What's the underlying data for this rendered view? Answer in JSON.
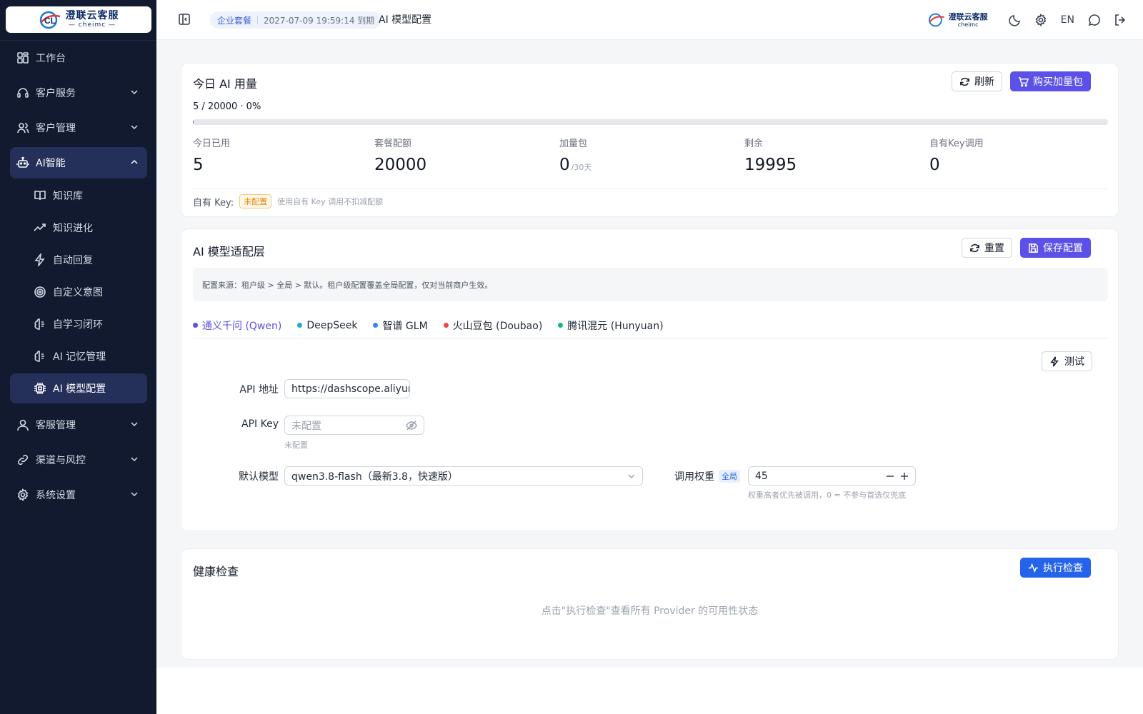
{
  "app": {
    "logo_title": "澄联云客服",
    "logo_sub": "cheimc"
  },
  "topbar": {
    "plan_name": "企业套餐",
    "plan_expiry": "2027-07-09 19:59:14 到期",
    "page_title": "AI 模型配置",
    "lang": "EN"
  },
  "sidebar": {
    "items": [
      {
        "label": "工作台",
        "icon": "dashboard-icon"
      },
      {
        "label": "客户服务",
        "icon": "headset-icon"
      },
      {
        "label": "客户管理",
        "icon": "users-icon"
      },
      {
        "label": "AI智能",
        "icon": "robot-icon"
      },
      {
        "label": "客服管理",
        "icon": "user-icon"
      },
      {
        "label": "渠道与风控",
        "icon": "link-icon"
      },
      {
        "label": "系统设置",
        "icon": "gear-icon"
      }
    ],
    "ai_sub": [
      {
        "label": "知识库",
        "icon": "book-icon"
      },
      {
        "label": "知识进化",
        "icon": "trend-icon"
      },
      {
        "label": "自动回复",
        "icon": "bolt-icon"
      },
      {
        "label": "自定义意图",
        "icon": "target-icon"
      },
      {
        "label": "自学习闭环",
        "icon": "brain-icon"
      },
      {
        "label": "AI 记忆管理",
        "icon": "brain-icon"
      },
      {
        "label": "AI 模型配置",
        "icon": "chip-icon"
      }
    ]
  },
  "usage": {
    "title": "今日 AI 用量",
    "refresh_label": "刷新",
    "buy_label": "购买加量包",
    "summary": "5 / 20000 · 0%",
    "progress_fraction": 0.00025,
    "stats": [
      {
        "label": "今日已用",
        "value": "5",
        "unit": ""
      },
      {
        "label": "套餐配额",
        "value": "20000",
        "unit": ""
      },
      {
        "label": "加量包",
        "value": "0",
        "unit": "/30天"
      },
      {
        "label": "剩余",
        "value": "19995",
        "unit": ""
      },
      {
        "label": "自有Key调用",
        "value": "0",
        "unit": ""
      }
    ],
    "own_key_label": "自有 Key:",
    "own_key_status": "未配置",
    "own_key_hint": "使用自有 Key 调用不扣减配额"
  },
  "model": {
    "title": "AI 模型适配层",
    "reset_label": "重置",
    "save_label": "保存配置",
    "info": "配置来源：租户级 > 全局 > 默认。租户级配置覆盖全局配置，仅对当前商户生效。",
    "tabs": [
      {
        "label": "通义千问 (Qwen)",
        "color": "#5b50e8"
      },
      {
        "label": "DeepSeek",
        "color": "#1ea7e0"
      },
      {
        "label": "智谱 GLM",
        "color": "#3b82f6"
      },
      {
        "label": "火山豆包 (Doubao)",
        "color": "#ef4444"
      },
      {
        "label": "腾讯混元 (Hunyuan)",
        "color": "#10b981"
      }
    ],
    "test_label": "测试",
    "api_url_label": "API 地址",
    "api_url_value": "https://dashscope.aliyun",
    "api_key_label": "API Key",
    "api_key_placeholder": "未配置",
    "api_key_hint": "未配置",
    "default_model_label": "默认模型",
    "default_model_value": "qwen3.8-flash（最新3.8，快速版）",
    "weight_label": "调用权重",
    "weight_tag": "全局",
    "weight_value": "45",
    "weight_hint": "权重高者优先被调用，0 = 不参与首选仅兜底"
  },
  "health": {
    "title": "健康检查",
    "run_label": "执行检查",
    "empty": "点击\"执行检查\"查看所有 Provider 的可用性状态"
  }
}
